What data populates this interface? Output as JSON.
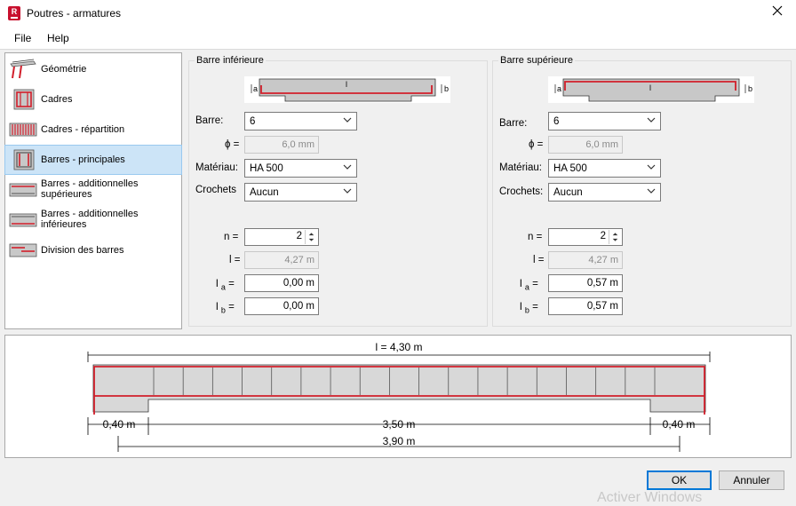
{
  "window": {
    "title": "Poutres - armatures",
    "app_icon_letter": "R"
  },
  "menu": [
    {
      "label": "File"
    },
    {
      "label": "Help"
    }
  ],
  "sidebar": {
    "items": [
      {
        "label": "Géométrie",
        "icon": "beam-geometry-icon"
      },
      {
        "label": "Cadres",
        "icon": "stirrups-icon"
      },
      {
        "label": "Cadres - répartition",
        "icon": "stirrups-distribution-icon"
      },
      {
        "label": "Barres - principales",
        "icon": "main-bars-icon",
        "selected": true
      },
      {
        "label": "Barres - additionnelles supérieures",
        "icon": "upper-additional-bars-icon"
      },
      {
        "label": "Barres - additionnelles inférieures",
        "icon": "lower-additional-bars-icon"
      },
      {
        "label": "Division des barres",
        "icon": "bar-division-icon"
      }
    ]
  },
  "lower_bar": {
    "title": "Barre inférieure",
    "diagram": {
      "a": "a",
      "l": "l",
      "b": "b"
    },
    "bar_label": "Barre:",
    "bar_value": "6",
    "phi_label": "ϕ =",
    "phi_value": "6,0 mm",
    "material_label": "Matériau:",
    "material_value": "HA 500",
    "hooks_label": "Crochets",
    "hooks_value": "Aucun",
    "n_label": "n =",
    "n_value": "2",
    "l_label": "l =",
    "l_value": "4,27 m",
    "la_label": "l",
    "la_sub": "a",
    "la_eq": "=",
    "la_value": "0,00 m",
    "lb_label": "l",
    "lb_sub": "b",
    "lb_eq": "=",
    "lb_value": "0,00 m"
  },
  "upper_bar": {
    "title": "Barre supérieure",
    "diagram": {
      "a": "a",
      "l": "l",
      "b": "b"
    },
    "bar_label": "Barre:",
    "bar_value": "6",
    "phi_label": "ϕ =",
    "phi_value": "6,0 mm",
    "material_label": "Matériau:",
    "material_value": "HA 500",
    "hooks_label": "Crochets:",
    "hooks_value": "Aucun",
    "n_label": "n =",
    "n_value": "2",
    "l_label": "l =",
    "l_value": "4,27 m",
    "la_label": "l",
    "la_sub": "a",
    "la_eq": "=",
    "la_value": "0,57 m",
    "lb_label": "l",
    "lb_sub": "b",
    "lb_eq": "=",
    "lb_value": "0,57 m"
  },
  "preview": {
    "total_length": "l = 4,30 m",
    "left_support": "0,40 m",
    "right_support": "0,40 m",
    "clear_span": "3,50 m",
    "axis_span": "3,90 m",
    "stirrup_segments": 19
  },
  "buttons": {
    "ok": "OK",
    "cancel": "Annuler"
  },
  "watermark": "Activer Windows",
  "colors": {
    "rebar": "#d21f2b",
    "concrete": "#d8d8d8",
    "accent": "#0078d7",
    "selection": "#cce4f7"
  }
}
